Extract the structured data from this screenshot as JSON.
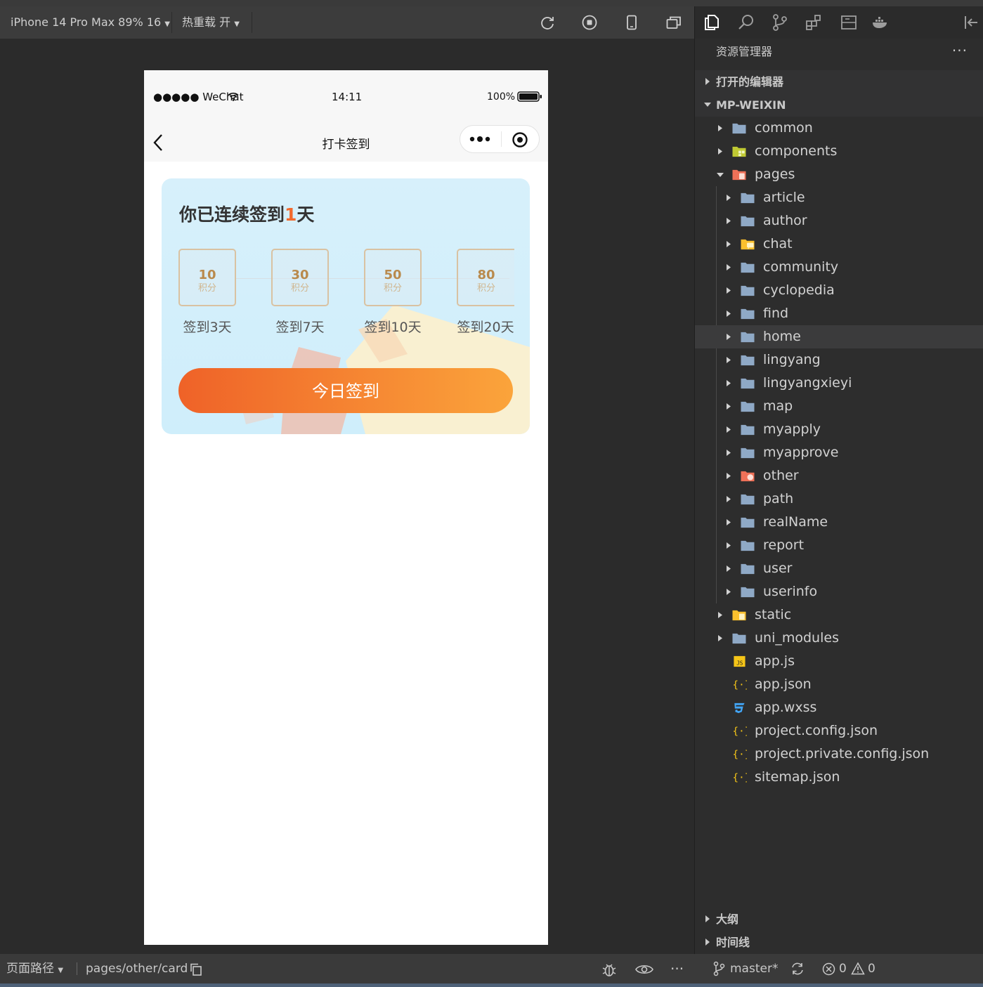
{
  "toolbar": {
    "device": "iPhone 14 Pro Max 89% 16",
    "hot_reload": "热重载 开"
  },
  "phone": {
    "status": {
      "signal": "●●●●● WeChat",
      "time": "14:11",
      "battery": "100%"
    },
    "nav_title": "打卡签到",
    "card": {
      "title_prefix": "你已连续签到",
      "streak_days": "1",
      "title_suffix": "天",
      "rewards": [
        {
          "points": "10",
          "unit": "积分",
          "caption": "签到3天"
        },
        {
          "points": "30",
          "unit": "积分",
          "caption": "签到7天"
        },
        {
          "points": "50",
          "unit": "积分",
          "caption": "签到10天"
        },
        {
          "points": "80",
          "unit": "积分",
          "caption": "签到20天"
        }
      ],
      "button": "今日签到"
    }
  },
  "explorer": {
    "title": "资源管理器",
    "more": "···",
    "sections": {
      "open_editors": "打开的编辑器",
      "project": "MP-WEIXIN",
      "outline": "大纲",
      "timeline": "时间线"
    },
    "tree": [
      {
        "label": "common",
        "icon": "folder-icon"
      },
      {
        "label": "components",
        "icon": "components-folder-icon"
      },
      {
        "label": "pages",
        "icon": "pages-folder-icon"
      },
      {
        "label": "article",
        "icon": "folder-icon"
      },
      {
        "label": "author",
        "icon": "folder-icon"
      },
      {
        "label": "chat",
        "icon": "chat-folder-icon"
      },
      {
        "label": "community",
        "icon": "folder-icon"
      },
      {
        "label": "cyclopedia",
        "icon": "folder-icon"
      },
      {
        "label": "find",
        "icon": "folder-icon"
      },
      {
        "label": "home",
        "icon": "folder-icon"
      },
      {
        "label": "lingyang",
        "icon": "folder-icon"
      },
      {
        "label": "lingyangxieyi",
        "icon": "folder-icon"
      },
      {
        "label": "map",
        "icon": "folder-icon"
      },
      {
        "label": "myapply",
        "icon": "folder-icon"
      },
      {
        "label": "myapprove",
        "icon": "folder-icon"
      },
      {
        "label": "other",
        "icon": "other-folder-icon"
      },
      {
        "label": "path",
        "icon": "folder-icon"
      },
      {
        "label": "realName",
        "icon": "folder-icon"
      },
      {
        "label": "report",
        "icon": "folder-icon"
      },
      {
        "label": "user",
        "icon": "folder-icon"
      },
      {
        "label": "userinfo",
        "icon": "folder-icon"
      },
      {
        "label": "static",
        "icon": "static-folder-icon"
      },
      {
        "label": "uni_modules",
        "icon": "folder-icon"
      },
      {
        "label": "app.js",
        "icon": "js-file-icon"
      },
      {
        "label": "app.json",
        "icon": "json-file-icon"
      },
      {
        "label": "app.wxss",
        "icon": "css-file-icon"
      },
      {
        "label": "project.config.json",
        "icon": "json-file-icon"
      },
      {
        "label": "project.private.config.json",
        "icon": "json-file-icon"
      },
      {
        "label": "sitemap.json",
        "icon": "json-file-icon"
      }
    ]
  },
  "statusbar": {
    "page_path_label": "页面路径",
    "page_path": "pages/other/card",
    "branch": "master*",
    "errors": "0",
    "warnings": "0"
  },
  "colors": {
    "accent_orange": "#f26a2e",
    "button_start": "#ef6228",
    "button_end": "#fba43b",
    "folder": "#8fa9c6"
  }
}
